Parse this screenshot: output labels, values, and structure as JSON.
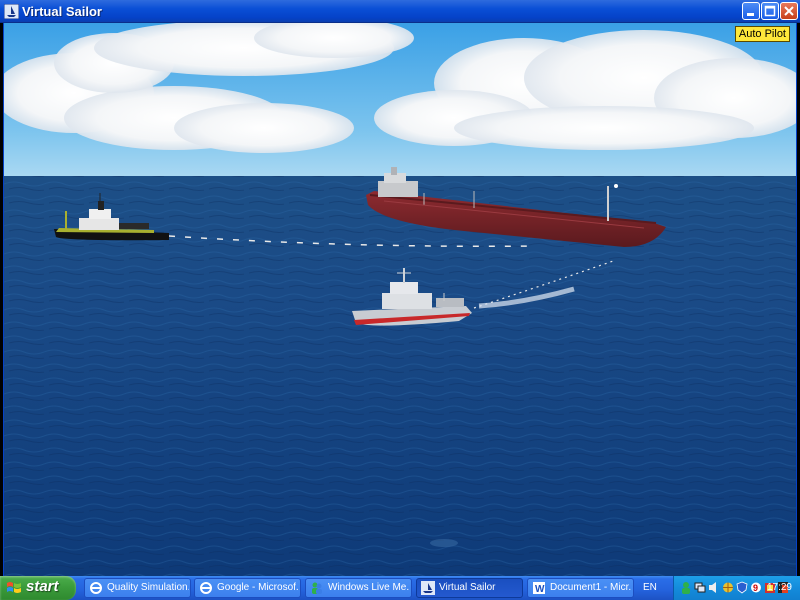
{
  "window": {
    "title": "Virtual Sailor",
    "icon": "virtual-sailor-app-icon",
    "controls": [
      "minimize-icon",
      "maximize-icon",
      "close-icon"
    ]
  },
  "scene": {
    "autopilot_label": "Auto Pilot",
    "colors": {
      "sky_top": "#3aa0e6",
      "sky_horizon": "#a9d8f2",
      "sea_far": "#1d4f86",
      "sea_near": "#0e3a78",
      "tanker_hull": "#7a2328"
    }
  },
  "taskbar": {
    "start_label": "start",
    "tasks": [
      {
        "label": "Quality Simulation...",
        "icon": "ie-icon",
        "active": false
      },
      {
        "label": "Google - Microsof...",
        "icon": "ie-icon",
        "active": false
      },
      {
        "label": "Windows Live Me...",
        "icon": "messenger-icon",
        "active": false
      },
      {
        "label": "Virtual Sailor",
        "icon": "virtual-sailor-app-icon",
        "active": true
      },
      {
        "label": "Document1 - Micr...",
        "icon": "word-icon",
        "active": false
      }
    ],
    "language": "EN",
    "tray_icons": [
      "user-icon",
      "network-icon",
      "volume-icon",
      "globe-icon",
      "shield-icon",
      "antivirus-icon",
      "help-icon",
      "flag-icon"
    ],
    "clock": "17:29"
  }
}
